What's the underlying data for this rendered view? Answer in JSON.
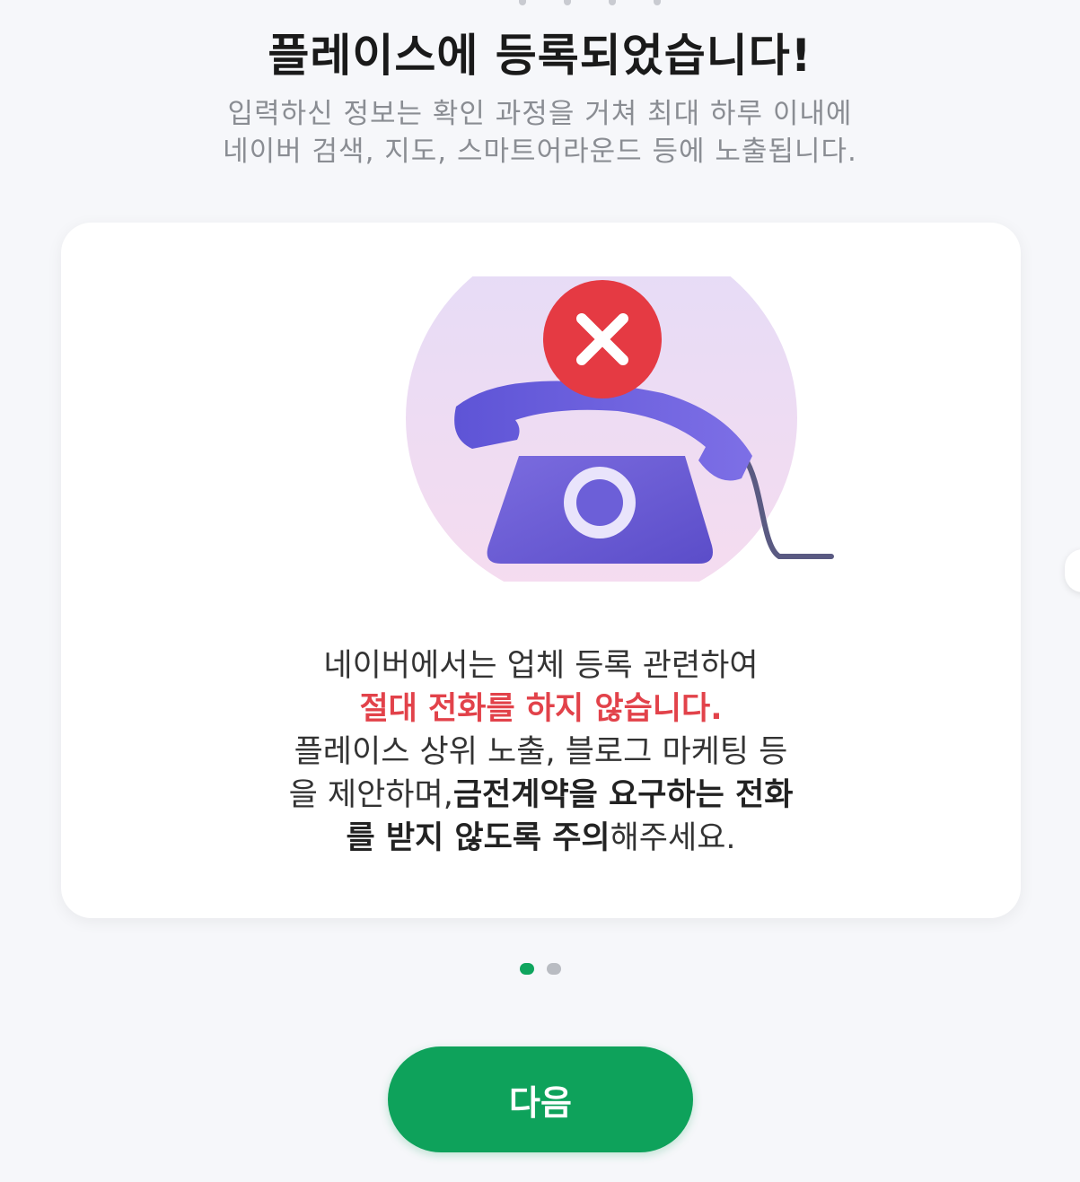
{
  "header": {
    "title": "플레이스에 등록되었습니다!",
    "subtitle_line1": "입력하신 정보는 확인 과정을 거쳐 최대 하루 이내에",
    "subtitle_line2": "네이버 검색, 지도, 스마트어라운드 등에 노출됩니다."
  },
  "card": {
    "illustration_icon": "blocked-phone-icon",
    "line1": "네이버에서는 업체 등록 관련하여",
    "warning": "절대 전화를 하지 않습니다.",
    "line3": "플레이스 상위 노출, 블로그 마케팅 등",
    "line4_normal": "을 제안하며,",
    "line4_bold": "금전계약을 요구하는 전화",
    "line5_bold": "를 받지 않도록 주의",
    "line5_normal": "해주세요."
  },
  "pager": {
    "total": 2,
    "active": 1
  },
  "actions": {
    "next_label": "다음"
  },
  "colors": {
    "accent": "#0ea25b",
    "warning": "#e2424a"
  }
}
